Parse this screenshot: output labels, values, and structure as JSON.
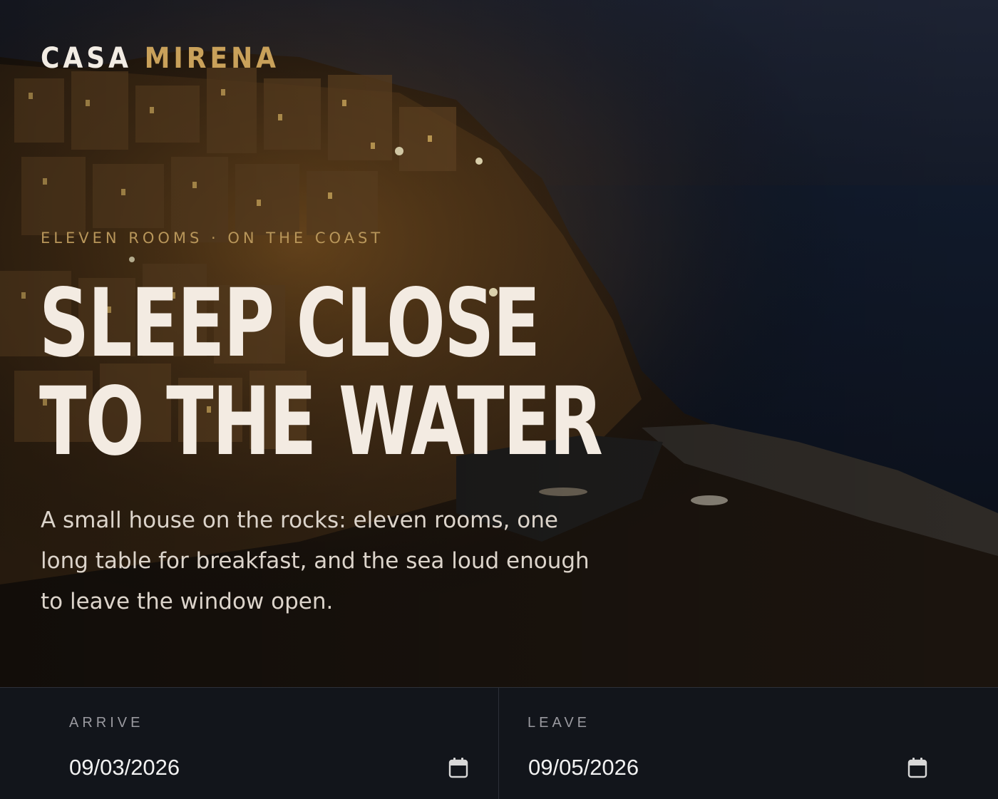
{
  "brand": {
    "name_part1": "CASA",
    "name_part2": "MIRENA"
  },
  "hero": {
    "eyebrow": "ELEVEN ROOMS · ON THE COAST",
    "headline_line1": "SLEEP CLOSE",
    "headline_line2": "TO THE WATER",
    "lede": "A small house on the rocks: eleven rooms, one long table for breakfast, and the sea loud enough to leave the window open.",
    "background_image": "night-cliff-village-by-the-sea"
  },
  "booking": {
    "arrive": {
      "label": "ARRIVE",
      "value": "09/03/2026",
      "icon": "calendar-icon"
    },
    "leave": {
      "label": "LEAVE",
      "value": "09/05/2026",
      "icon": "calendar-icon"
    }
  },
  "colors": {
    "accent": "#c9a15a",
    "headline": "#f3ebe2",
    "bar_background": "#12151b"
  }
}
